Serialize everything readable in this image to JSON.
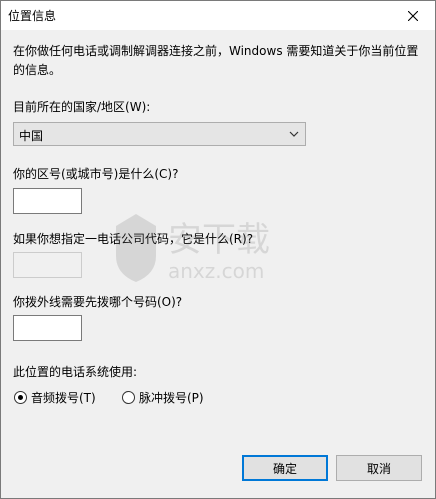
{
  "window": {
    "title": "位置信息"
  },
  "description": "在你做任何电话或调制解调器连接之前，Windows 需要知道关于你当前位置的信息。",
  "country": {
    "label": "目前所在的国家/地区(W):",
    "selected": "中国"
  },
  "area_code": {
    "label": "你的区号(或城市号)是什么(C)?",
    "value": ""
  },
  "carrier_code": {
    "label": "如果你想指定一电话公司代码，它是什么(R)?",
    "value": ""
  },
  "outside_line": {
    "label": "你拨外线需要先拨哪个号码(O)?",
    "value": ""
  },
  "dial_system": {
    "label": "此位置的电话系统使用:",
    "options": [
      {
        "label": "音频拨号(T)",
        "checked": true
      },
      {
        "label": "脉冲拨号(P)",
        "checked": false
      }
    ]
  },
  "buttons": {
    "ok": "确定",
    "cancel": "取消"
  },
  "watermark": {
    "text": "安下载",
    "subtext": "anxz.com"
  }
}
